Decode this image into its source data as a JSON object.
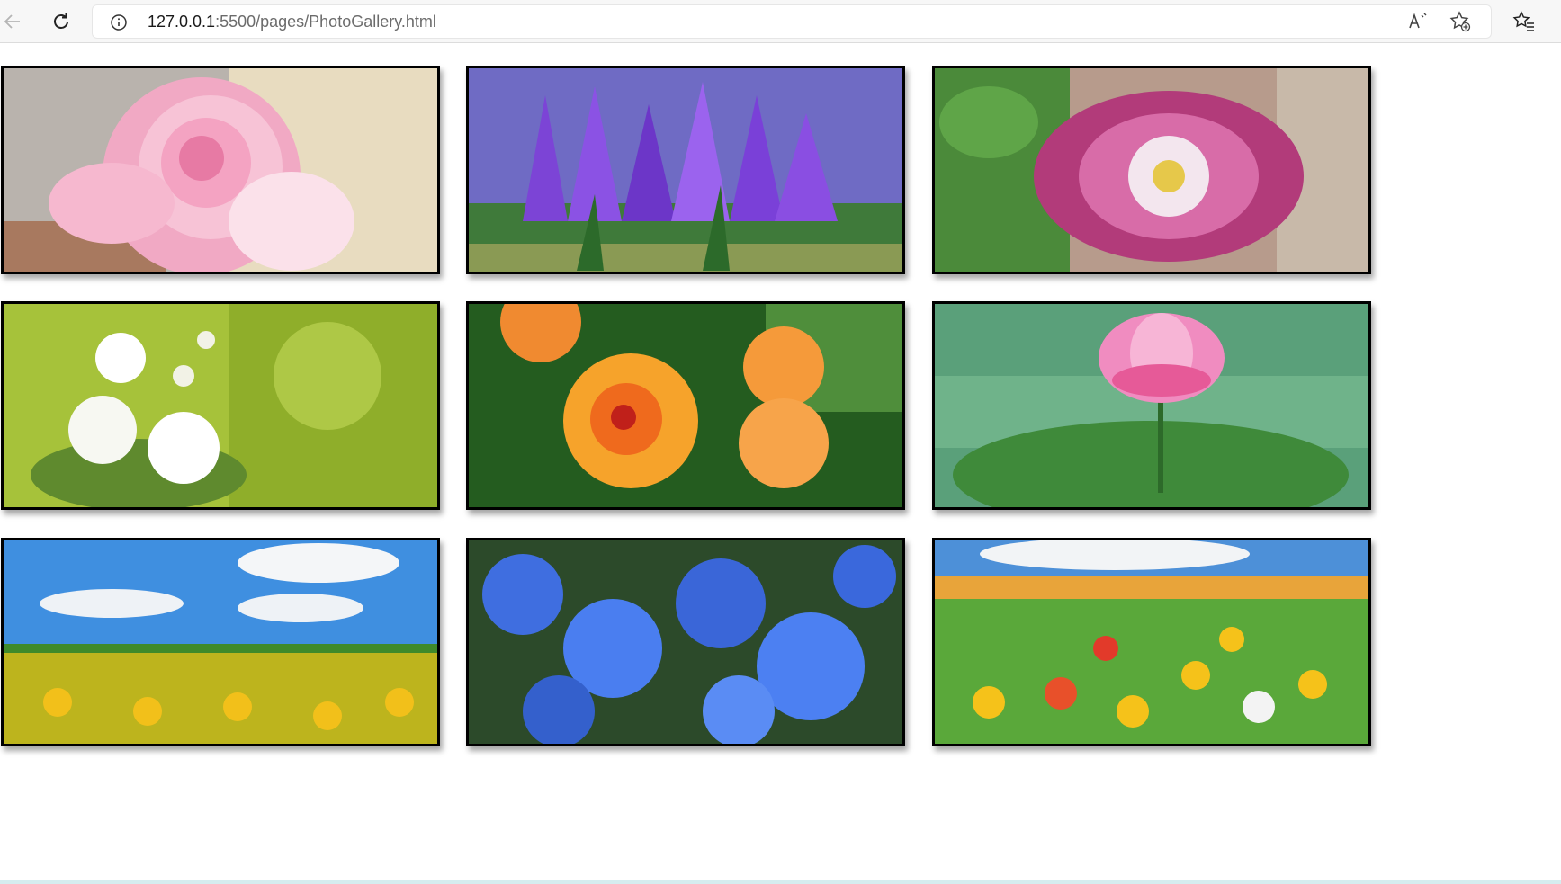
{
  "browser": {
    "url_host": "127.0.0.1",
    "url_path": ":5500/pages/PhotoGallery.html",
    "icons": [
      "back-arrow-icon",
      "reload-icon",
      "info-icon",
      "read-aloud-icon",
      "add-favorite-icon",
      "favorites-icon"
    ]
  },
  "gallery": {
    "photos": [
      {
        "subject": "pink rose"
      },
      {
        "subject": "purple crocuses in rain"
      },
      {
        "subject": "magenta passion flower"
      },
      {
        "subject": "white jasmine"
      },
      {
        "subject": "orange hibiscus"
      },
      {
        "subject": "pink lotus"
      },
      {
        "subject": "sunflower field"
      },
      {
        "subject": "blue forget-me-nots"
      },
      {
        "subject": "tulip field"
      }
    ]
  }
}
